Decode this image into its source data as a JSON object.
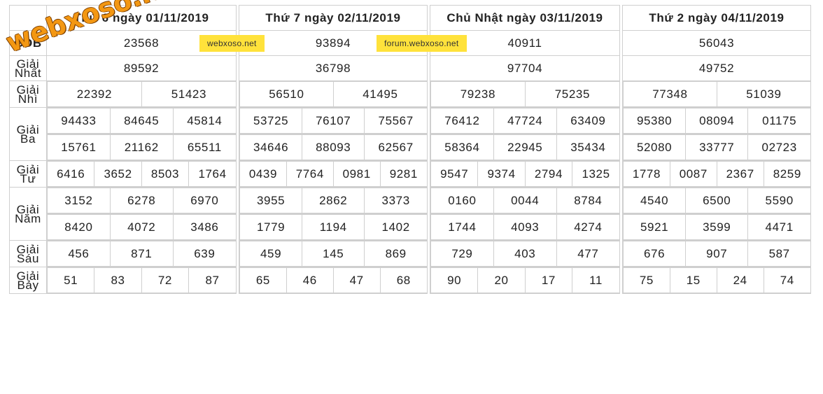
{
  "days": [
    {
      "header": "Thứ 6 ngày 01/11/2019",
      "gdb": "23568",
      "nhat": "89592",
      "nhi": [
        "22392",
        "51423"
      ],
      "ba": [
        "94433",
        "84645",
        "45814",
        "15761",
        "21162",
        "65511"
      ],
      "tu": [
        "6416",
        "3652",
        "8503",
        "1764"
      ],
      "nam": [
        "3152",
        "6278",
        "6970",
        "8420",
        "4072",
        "3486"
      ],
      "sau": [
        "456",
        "871",
        "639"
      ],
      "bay": [
        "51",
        "83",
        "72",
        "87"
      ]
    },
    {
      "header": "Thứ 7 ngày 02/11/2019",
      "gdb": "93894",
      "nhat": "36798",
      "nhi": [
        "56510",
        "41495"
      ],
      "ba": [
        "53725",
        "76107",
        "75567",
        "34646",
        "88093",
        "62567"
      ],
      "tu": [
        "0439",
        "7764",
        "0981",
        "9281"
      ],
      "nam": [
        "3955",
        "2862",
        "3373",
        "1779",
        "1194",
        "1402"
      ],
      "sau": [
        "459",
        "145",
        "869"
      ],
      "bay": [
        "65",
        "46",
        "47",
        "68"
      ]
    },
    {
      "header": "Chủ Nhật ngày 03/11/2019",
      "gdb": "40911",
      "nhat": "97704",
      "nhi": [
        "79238",
        "75235"
      ],
      "ba": [
        "76412",
        "47724",
        "63409",
        "58364",
        "22945",
        "35434"
      ],
      "tu": [
        "9547",
        "9374",
        "2794",
        "1325"
      ],
      "nam": [
        "0160",
        "0044",
        "8784",
        "1744",
        "4093",
        "4274"
      ],
      "sau": [
        "729",
        "403",
        "477"
      ],
      "bay": [
        "90",
        "20",
        "17",
        "11"
      ]
    },
    {
      "header": "Thứ 2 ngày 04/11/2019",
      "gdb": "56043",
      "nhat": "49752",
      "nhi": [
        "77348",
        "51039"
      ],
      "ba": [
        "95380",
        "08094",
        "01175",
        "52080",
        "33777",
        "02723"
      ],
      "tu": [
        "1778",
        "0087",
        "2367",
        "8259"
      ],
      "nam": [
        "4540",
        "6500",
        "5590",
        "5921",
        "3599",
        "4471"
      ],
      "sau": [
        "676",
        "907",
        "587"
      ],
      "bay": [
        "75",
        "15",
        "24",
        "74"
      ]
    }
  ],
  "labels": {
    "gdb": "GĐB",
    "nhat": "Giải Nhất",
    "nhi": "Giải Nhì",
    "ba": "Giải Ba",
    "tu": "Giải Tư",
    "nam": "Giải Năm",
    "sau": "Giải Sáu",
    "bay": "Giải Bảy"
  },
  "watermark": "webxoso.net",
  "badges": [
    "webxoso.net",
    "forum.webxoso.net"
  ],
  "colors": {
    "special_prize": "#e01010",
    "badge_bg": "#ffe23b",
    "watermark": "#f39712"
  }
}
